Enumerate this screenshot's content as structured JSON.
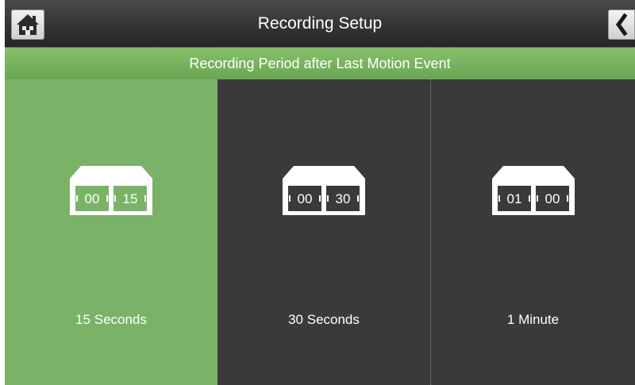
{
  "header": {
    "title": "Recording Setup",
    "home_icon": "home-icon",
    "back_icon": "back-chevron-icon"
  },
  "subheader": {
    "text": "Recording Period after Last Motion Event"
  },
  "options": [
    {
      "label": "15 Seconds",
      "minutes": "00",
      "seconds": "15",
      "selected": true
    },
    {
      "label": "30 Seconds",
      "minutes": "00",
      "seconds": "30",
      "selected": false
    },
    {
      "label": "1 Minute",
      "minutes": "01",
      "seconds": "00",
      "selected": false
    }
  ],
  "colors": {
    "accent_green": "#7ab367",
    "panel_dark": "#3a3a3c",
    "titlebar_dark": "#343434"
  }
}
